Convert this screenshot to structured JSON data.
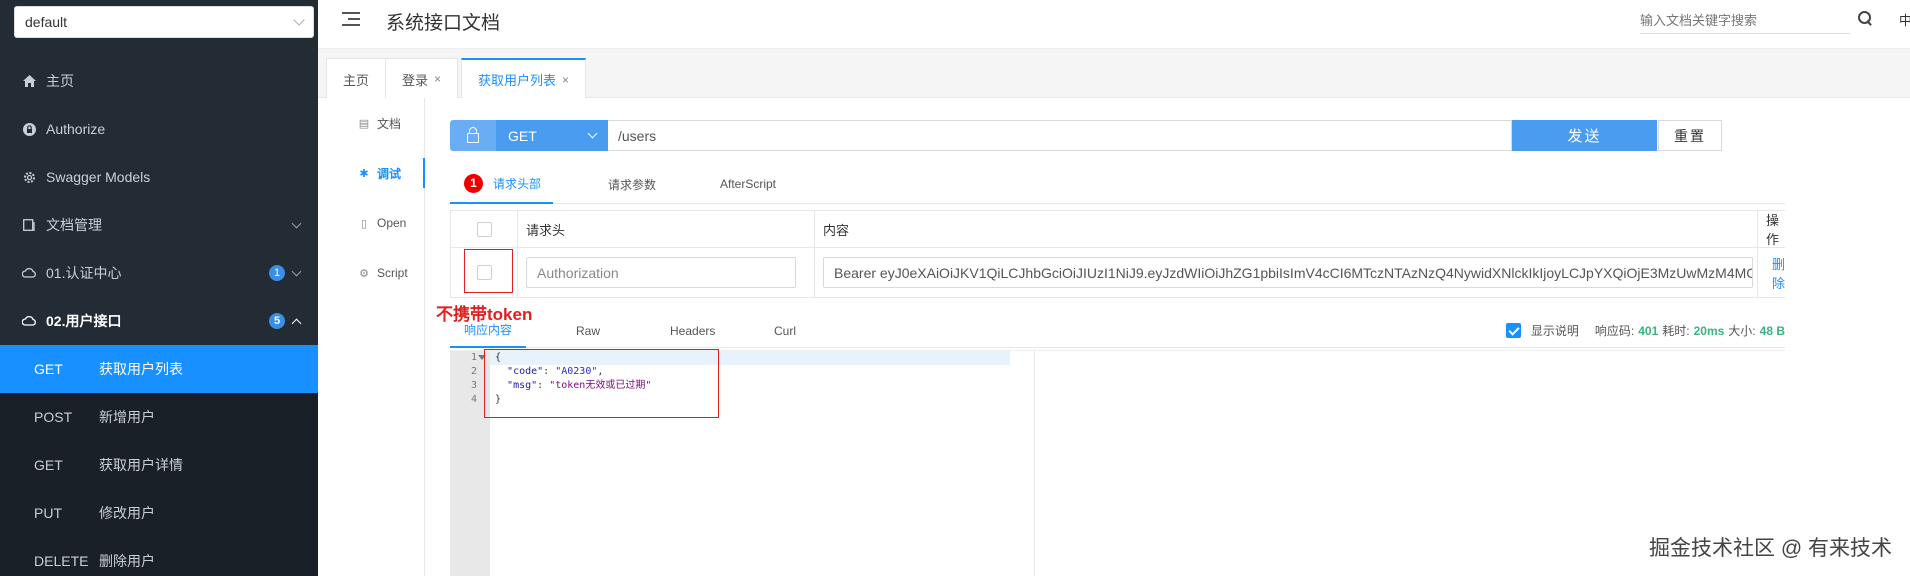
{
  "sidebar": {
    "group_select": "default",
    "items": [
      {
        "label": "主页",
        "icon": "home-icon"
      },
      {
        "label": "Authorize",
        "icon": "lock-icon"
      },
      {
        "label": "Swagger Models",
        "icon": "gear-icon"
      },
      {
        "label": "文档管理",
        "icon": "folder-icon"
      },
      {
        "label": "01.认证中心",
        "icon": "cloud-icon",
        "badge": "1"
      },
      {
        "label": "02.用户接口",
        "icon": "cloud-icon",
        "badge": "5"
      }
    ],
    "sub_items": [
      {
        "method": "GET",
        "label": "获取用户列表"
      },
      {
        "method": "POST",
        "label": "新增用户"
      },
      {
        "method": "GET",
        "label": "获取用户详情"
      },
      {
        "method": "PUT",
        "label": "修改用户"
      },
      {
        "method": "DELETE",
        "label": "删除用户"
      }
    ]
  },
  "header": {
    "title": "系统接口文档",
    "search_placeholder": "输入文档关键字搜索",
    "lang": "中"
  },
  "tabs": [
    {
      "label": "主页"
    },
    {
      "label": "登录",
      "close": "×"
    },
    {
      "label": "获取用户列表",
      "close": "×"
    }
  ],
  "doc_nav": [
    {
      "label": "文档"
    },
    {
      "label": "调试"
    },
    {
      "label": "Open"
    },
    {
      "label": "Script"
    }
  ],
  "request": {
    "method": "GET",
    "url": "/users",
    "send_label": "发送",
    "reset_label": "重置"
  },
  "req_tabs": {
    "step": "1",
    "headers": "请求头部",
    "params": "请求参数",
    "after": "AfterScript"
  },
  "header_table": {
    "columns": [
      "请求头",
      "内容",
      "操作"
    ],
    "row": {
      "name": "Authorization",
      "value": "Bearer eyJ0eXAiOiJKV1QiLCJhbGciOiJIUzI1NiJ9.eyJzdWIiOiJhZG1pbiIsImV4cCI6MTczNTAzNzQ4NywidXNlckIkIjoyLCJpYXQiOjE3MzUwMzM4MC",
      "action": "删除"
    }
  },
  "annotation": "不携带token",
  "response": {
    "tabs": [
      "响应内容",
      "Raw",
      "Headers",
      "Curl"
    ],
    "show_desc": "显示说明",
    "code_label": "响应码:",
    "code": "401",
    "time_label": "耗时:",
    "time": "20ms",
    "size_label": "大小:",
    "size": "48 B",
    "line_numbers": [
      "1",
      "2",
      "3",
      "4"
    ],
    "body_open": "{",
    "body_close": "}",
    "code_key": "\"code\"",
    "code_val": "\"A0230\"",
    "msg_key": "\"msg\"",
    "msg_val": "\"token无效或已过期\""
  },
  "watermark": "掘金技术社区 @ 有来技术"
}
